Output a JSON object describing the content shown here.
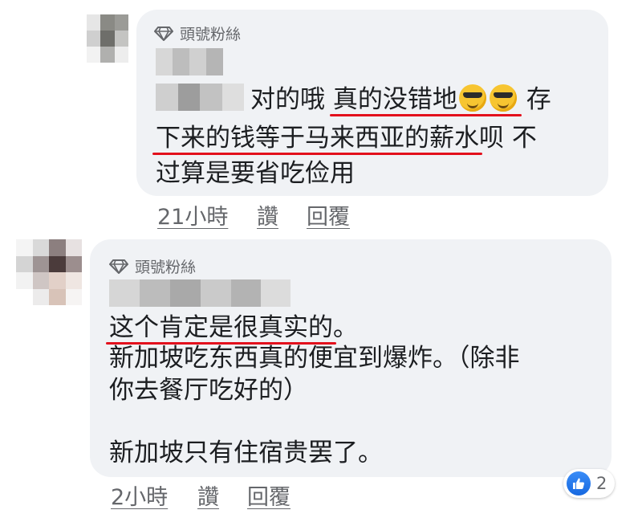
{
  "comments": [
    {
      "badge": "頭號粉絲",
      "line1_a": "对的哦 ",
      "line1_u": "真的没错地",
      "line1_b": " 存",
      "line2_u": "下来的钱等于马来西亚的薪水",
      "line2_b": "呗 不",
      "line3": "过算是要省吃俭用",
      "emoji": [
        "sunglasses-emoji",
        "sunglasses-emoji"
      ],
      "time": "21小時",
      "like": "讚",
      "reply": "回覆"
    },
    {
      "badge": "頭號粉絲",
      "line1_u": "这个肯定是很真实的",
      "line1_b": "。",
      "line2": "新加坡吃东西真的便宜到爆炸。（除非",
      "line3": "你去餐厅吃好的）",
      "line5": "新加坡只有住宿贵罢了。",
      "time": "2小時",
      "like": "讚",
      "reply": "回覆",
      "reaction_count": "2"
    }
  ],
  "colors": {
    "bubble": "#f0f2f5",
    "underline": "#e3101c",
    "meta": "#65676b",
    "like": "#1877f2"
  }
}
